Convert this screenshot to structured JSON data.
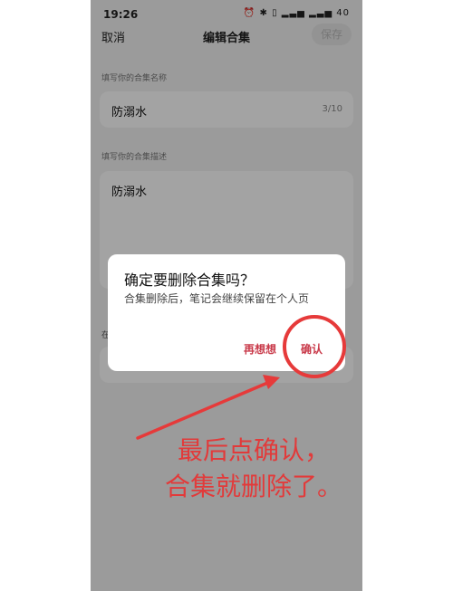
{
  "status_bar": {
    "time": "19:26",
    "icons": "⏰ ✱ ▯ ▂▃▅ ▂▃▅ 40"
  },
  "nav": {
    "cancel": "取消",
    "title": "编辑合集",
    "save": "保存"
  },
  "name_section": {
    "label": "填写你的合集名称",
    "value": "防溺水",
    "count": "3/10"
  },
  "desc_section": {
    "label": "填写你的合集描述",
    "value": "防溺水"
  },
  "hidden_section_label": "在",
  "dialog": {
    "title": "确定要删除合集吗？",
    "message": "合集删除后，笔记会继续保留在个人页",
    "cancel": "再想想",
    "confirm": "确认"
  },
  "annotation": {
    "line1": "最后点确认，",
    "line2": "合集就删除了。",
    "color": "#e23a3a"
  }
}
